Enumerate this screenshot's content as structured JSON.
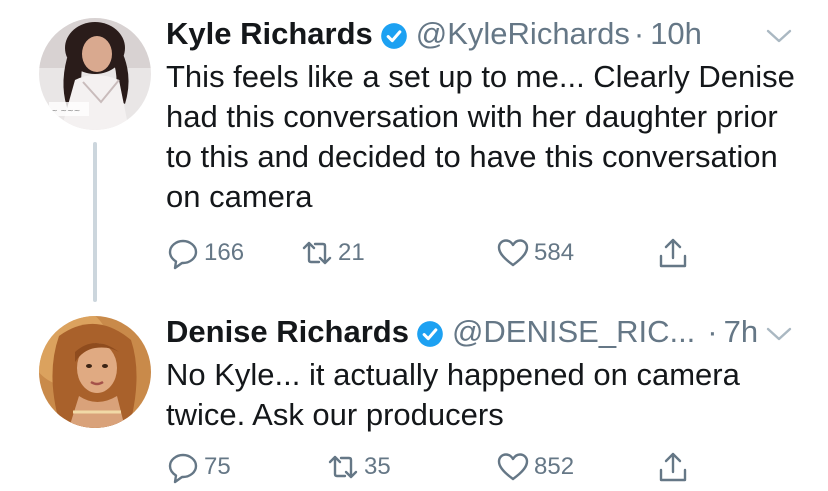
{
  "tweets": [
    {
      "author_name": "Kyle Richards",
      "handle": "@KyleRichards",
      "dot": "·",
      "time": "10h",
      "avatar_icon": "kyle-richards-avatar",
      "text": "This feels like a set up to me... Clearly Denise had this conversation with her daughter prior to this and decided to have this conversation on camera",
      "replies": "166",
      "retweets": "21",
      "likes": "584"
    },
    {
      "author_name": "Denise Richards",
      "handle": "@DENISE_RIC...",
      "dot": "·",
      "time": "7h",
      "avatar_icon": "denise-richards-avatar",
      "text": "No Kyle... it actually happened on camera twice. Ask our producers",
      "replies": "75",
      "retweets": "35",
      "likes": "852"
    }
  ],
  "colors": {
    "verified": "#1da1f2",
    "muted": "#657786",
    "text": "#14171a",
    "thread": "#ccd6dd"
  }
}
